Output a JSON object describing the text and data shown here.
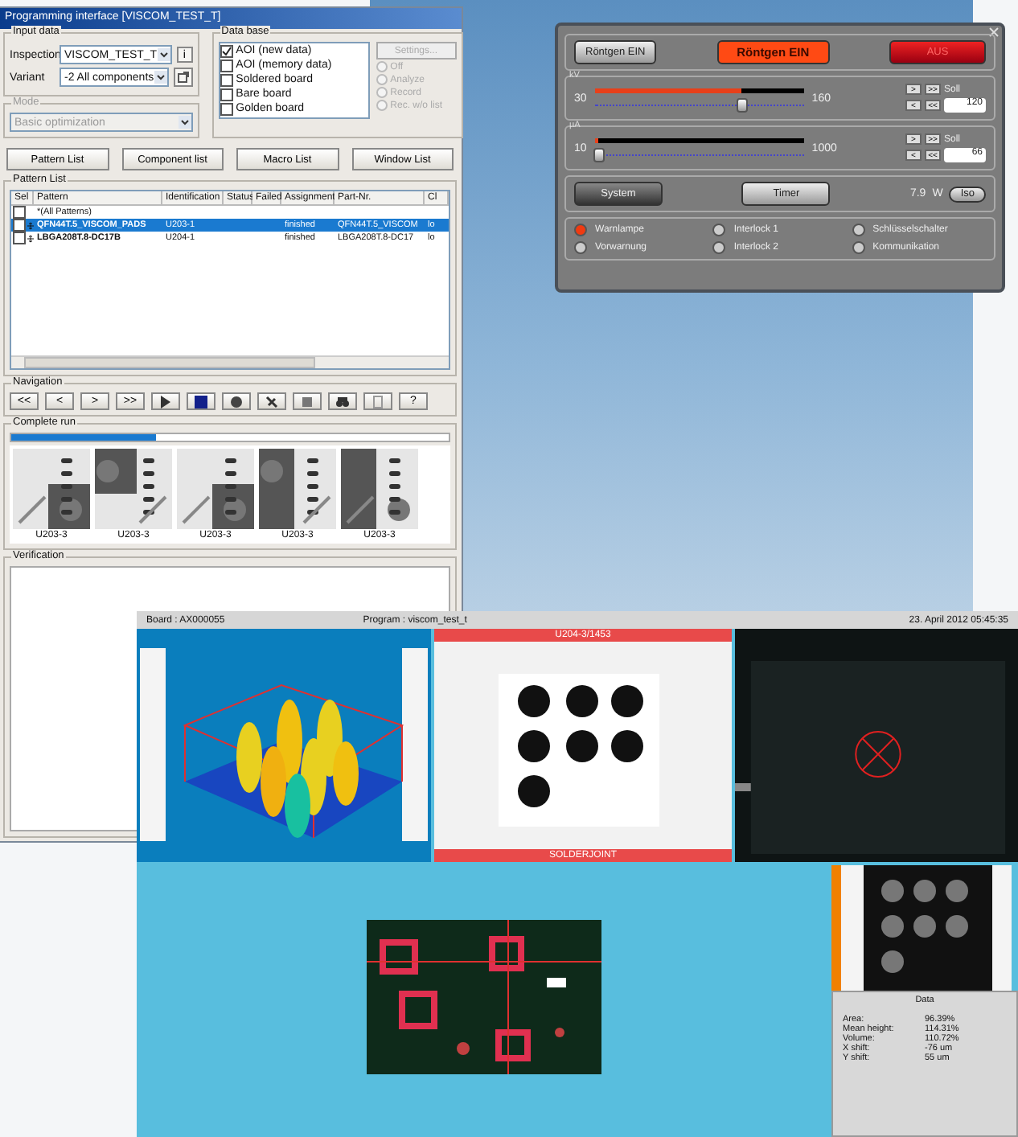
{
  "programming_window": {
    "title": "Programming interface [VISCOM_TEST_T]",
    "input_data": {
      "label": "Input data",
      "inspection_label": "Inspection",
      "inspection": "VISCOM_TEST_T",
      "info_button": "i",
      "variant_label": "Variant",
      "variant": "-2   All components"
    },
    "mode": {
      "label": "Mode",
      "value": "Basic optimization",
      "disabled": true
    },
    "database": {
      "label": "Data base",
      "items": [
        {
          "label": "AOI (new data)",
          "checked": true
        },
        {
          "label": "AOI (memory data)",
          "checked": false
        },
        {
          "label": "Soldered board",
          "checked": false
        },
        {
          "label": "Bare board",
          "checked": false
        },
        {
          "label": "Golden board",
          "checked": false
        }
      ],
      "settings_button": {
        "label": "Settings...",
        "disabled": true
      },
      "modes": [
        {
          "label": "Off",
          "selected": false,
          "disabled": true
        },
        {
          "label": "Analyze",
          "selected": false,
          "disabled": true
        },
        {
          "label": "Record",
          "selected": false,
          "disabled": true
        },
        {
          "label": "Rec. w/o list",
          "selected": false,
          "disabled": true
        }
      ]
    },
    "list_buttons": [
      "Pattern List",
      "Component list",
      "Macro List",
      "Window List"
    ],
    "pattern_list": {
      "label": "Pattern List",
      "columns": [
        "Sel",
        "Pattern",
        "Identification",
        "Status",
        "Failed",
        "Assignment",
        "Part-Nr.",
        "Cl"
      ],
      "rows": [
        {
          "kind": "all",
          "checked": false,
          "selected": false,
          "cells": [
            "",
            "*(All Patterns)",
            "",
            "",
            "",
            "",
            "",
            ""
          ]
        },
        {
          "kind": "pattern",
          "checked": false,
          "selected": true,
          "cells": [
            "",
            "QFN44T.5_VISCOM_PADS",
            "U203-1",
            "",
            "",
            "finished",
            "QFN44T.5_VISCOM",
            "lo"
          ]
        },
        {
          "kind": "pattern",
          "checked": false,
          "selected": false,
          "cells": [
            "",
            "LBGA208T.8-DC17B",
            "U204-1",
            "",
            "",
            "finished",
            "LBGA208T.8-DC17",
            "lo"
          ]
        }
      ]
    },
    "navigation": {
      "label": "Navigation",
      "buttons": [
        {
          "kind": "text",
          "label": "<<"
        },
        {
          "kind": "text",
          "label": "<"
        },
        {
          "kind": "text",
          "label": ">"
        },
        {
          "kind": "text",
          "label": ">>"
        },
        {
          "kind": "play"
        },
        {
          "kind": "stop"
        },
        {
          "kind": "record"
        },
        {
          "kind": "tool"
        },
        {
          "kind": "square"
        },
        {
          "kind": "binoculars"
        },
        {
          "kind": "document"
        },
        {
          "kind": "text",
          "label": "?"
        }
      ]
    },
    "complete_run": {
      "label": "Complete run",
      "level": 0.33,
      "thumbnails": [
        {
          "caption": "U203-3"
        },
        {
          "caption": "U203-3"
        },
        {
          "caption": "U203-3"
        },
        {
          "caption": "U203-3"
        },
        {
          "caption": "U203-3"
        }
      ]
    },
    "verification": {
      "label": "Verification"
    }
  },
  "xray_panel": {
    "buttons": [
      {
        "label": "Röntgen EIN",
        "kind": "plain"
      },
      {
        "label": "Röntgen EIN",
        "kind": "active"
      },
      {
        "label": "AUS",
        "kind": "off"
      }
    ],
    "sliders": [
      {
        "unit": "kV",
        "min": "30",
        "max": "160",
        "level": 0.7,
        "setpoint_label": "Soll",
        "setpoint": "120",
        "buttons": [
          ">",
          ">>",
          "<",
          "<<"
        ]
      },
      {
        "unit": "µA",
        "min": "10",
        "max": "1000",
        "level": 0.02,
        "setpoint_label": "Soll",
        "setpoint": "66",
        "buttons": [
          ">",
          ">>",
          "<",
          "<<"
        ]
      }
    ],
    "system_button": "System",
    "timer_button": "Timer",
    "power": "7.9",
    "power_unit": "W",
    "iso_button": "Iso",
    "indicators": [
      {
        "label": "Warnlampe",
        "on": true
      },
      {
        "label": "Interlock 1",
        "on": false
      },
      {
        "label": "Schlüsselschalter",
        "on": false
      },
      {
        "label": "Vorwarnung",
        "on": false
      },
      {
        "label": "Interlock 2",
        "on": false
      },
      {
        "label": "Kommunikation",
        "on": false
      }
    ]
  },
  "inspection_window": {
    "board": "Board : AX000055",
    "program": "Program : viscom_test_t",
    "datetime": "23. April 2012    05:45:35",
    "xray_view": {
      "title": "U204-3/1453",
      "footer": "SOLDERJOINT"
    },
    "data": {
      "title": "Data",
      "rows": [
        {
          "label": "Area:",
          "value": "96.39%"
        },
        {
          "label": "Mean height:",
          "value": "114.31%"
        },
        {
          "label": "Volume:",
          "value": "110.72%"
        },
        {
          "label": "X shift:",
          "value": "-76 um"
        },
        {
          "label": "Y shift:",
          "value": "55 um"
        }
      ]
    }
  }
}
